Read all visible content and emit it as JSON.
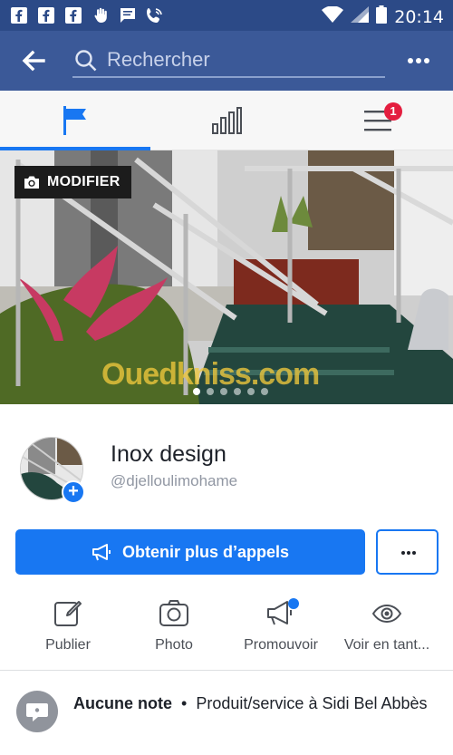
{
  "status_bar": {
    "time": "20:14"
  },
  "search": {
    "placeholder": "Rechercher"
  },
  "tabs": {
    "notifications_badge": "1"
  },
  "cover": {
    "modify_label": "MODIFIER",
    "watermark": "Ouedkniss.com"
  },
  "profile": {
    "name": "Inox design",
    "handle": "@djelloulimohame"
  },
  "actions": {
    "cta_label": "Obtenir plus d’appels"
  },
  "quick_actions": [
    {
      "label": "Publier"
    },
    {
      "label": "Photo"
    },
    {
      "label": "Promouvoir"
    },
    {
      "label": "Voir en tant..."
    }
  ],
  "info": {
    "rating": "Aucune note",
    "separator": "•",
    "category": "Produit/service à Sidi Bel Abbès"
  },
  "colors": {
    "header": "#3b5998",
    "status_bar": "#2c4a87",
    "accent": "#1877f2",
    "badge": "#e41e3f"
  }
}
